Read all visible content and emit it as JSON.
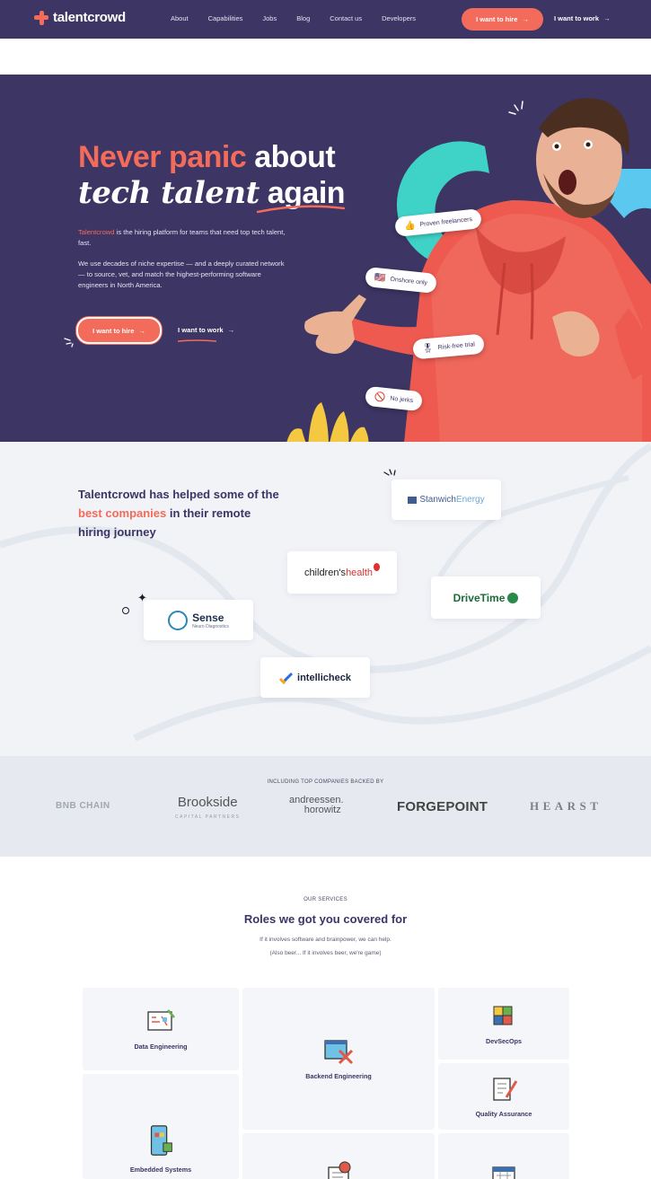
{
  "nav": {
    "brand": "talentcrowd",
    "links": [
      "About",
      "Capabilities",
      "Jobs",
      "Blog",
      "Contact us",
      "Developers"
    ],
    "cta_hire": "I want to hire",
    "cta_work": "I want to work",
    "arrow": "→"
  },
  "hero": {
    "title_coral": "Never panic",
    "title_white1": " about",
    "title_script": "tech talent",
    "title_white2": " again",
    "p1_brand": "Talentcrowd",
    "p1_rest": " is the hiring platform for teams that need top tech talent, fast.",
    "p2": "We use decades of niche expertise — and a deeply curated network — to source, vet, and match the highest-performing software engineers in North America.",
    "cta_hire": "I want to hire",
    "cta_work": "I want to work",
    "chips": [
      {
        "icon": "thumbs-up-icon",
        "glyph": "👍",
        "label": "Proven freelancers"
      },
      {
        "icon": "usa-flag-icon",
        "glyph": "🇺🇸",
        "label": "Onshore only"
      },
      {
        "icon": "ribbon-icon",
        "glyph": "🎖",
        "label": "Risk-free trial"
      },
      {
        "icon": "no-icon",
        "glyph": "🚫",
        "label": "No jerks"
      }
    ]
  },
  "clients": {
    "title_pre": "Talentcrowd has helped some of the ",
    "title_coral": "best companies",
    "title_post": " in their remote hiring journey",
    "stanwich_a": "Stanwich",
    "stanwich_b": "Energy",
    "childrens_a": "children's",
    "childrens_b": "health",
    "drivetime": "DriveTime",
    "sense_name": "Sense",
    "sense_sub": "Neuro Diagnostics",
    "intellicheck": "intellicheck"
  },
  "backed": {
    "label": "INCLUDING TOP COMPANIES BACKED BY",
    "bnb": "BNB CHAIN",
    "brookside": "Brookside",
    "brookside_sub": "CAPITAL PARTNERS",
    "a16z_1": "andreessen.",
    "a16z_2": "horowitz",
    "forgepoint": "FORGEPOINT",
    "hearst": "HEARST"
  },
  "services": {
    "eyebrow": "OUR SERVICES",
    "title": "Roles we got you covered for",
    "sub1": "If it involves software and brainpower, we can help.",
    "sub2": "(Also beer... If it involves beer, we're game)",
    "cards": {
      "data": "Data Engineering",
      "backend": "Backend Engineering",
      "devsecops": "DevSecOps",
      "qa": "Quality Assurance",
      "embedded": "Embedded Systems"
    }
  },
  "colors": {
    "navy": "#3d3563",
    "coral": "#f26b5b",
    "teal": "#3fd3c8",
    "yellow": "#f5c842",
    "light_bg": "#f1f3f7"
  }
}
